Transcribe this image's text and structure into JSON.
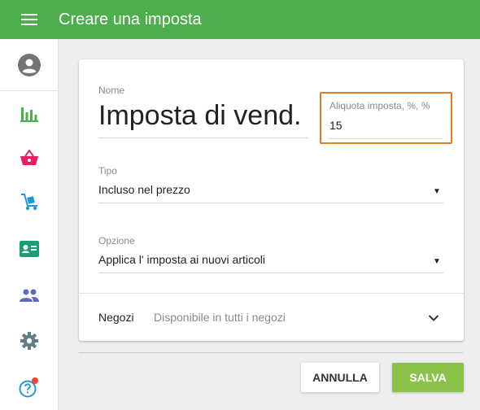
{
  "header": {
    "title": "Creare una imposta"
  },
  "sidebar": {
    "items": [
      {
        "icon": "account-circle-icon"
      },
      {
        "icon": "reports-chart-icon",
        "color": "#4cae4c"
      },
      {
        "icon": "shopping-basket-icon",
        "color": "#e91e63"
      },
      {
        "icon": "inventory-dolly-icon",
        "color": "#1e9ad6"
      },
      {
        "icon": "employee-card-icon",
        "color": "#1b9e77"
      },
      {
        "icon": "customers-people-icon",
        "color": "#5c6bc0"
      },
      {
        "icon": "settings-gear-icon",
        "color": "#607d8b"
      },
      {
        "icon": "help-icon",
        "color": "#1e9ad6",
        "badge_color": "#f44336"
      }
    ]
  },
  "form": {
    "name_label": "Nome",
    "name_value": "Imposta di vend.",
    "rate_label": "Aliquota imposta, %, %",
    "rate_value": "15",
    "type_label": "Tipo",
    "type_value": "Incluso nel prezzo",
    "option_label": "Opzione",
    "option_value": "Applica l' imposta ai nuovi articoli",
    "stores_label": "Negozi",
    "stores_value": "Disponibile in tutti i negozi",
    "dropdown_arrow": "▼"
  },
  "actions": {
    "cancel_label": "ANNULLA",
    "save_label": "SALVA"
  },
  "colors": {
    "primary": "#4cae4c",
    "save_button": "#8bc34a",
    "focus_border": "#e07b22"
  }
}
